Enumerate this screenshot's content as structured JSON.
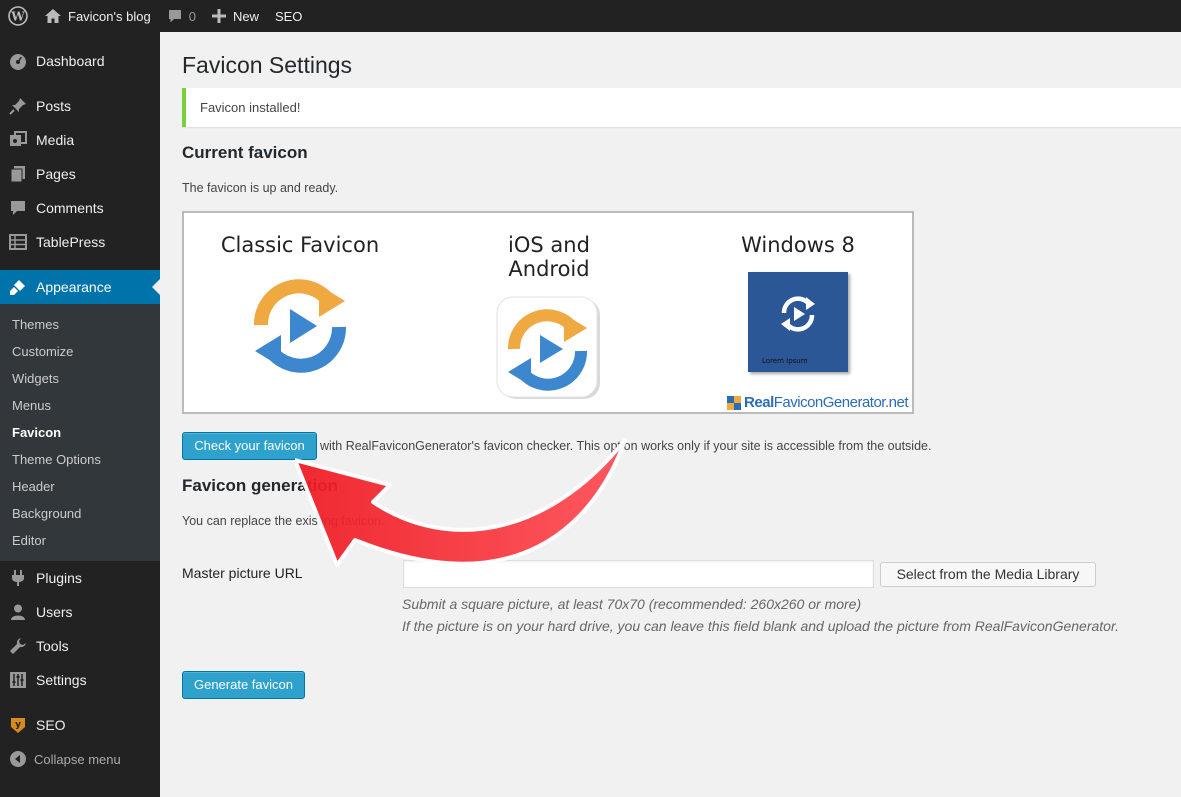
{
  "adminbar": {
    "site_name": "Favicon's blog",
    "comments_count": "0",
    "new_label": "New",
    "seo_label": "SEO"
  },
  "sidebar": {
    "items": [
      {
        "label": "Dashboard",
        "icon": "dashboard-icon"
      },
      {
        "label": "Posts",
        "icon": "pin-icon"
      },
      {
        "label": "Media",
        "icon": "media-icon"
      },
      {
        "label": "Pages",
        "icon": "pages-icon"
      },
      {
        "label": "Comments",
        "icon": "comment-icon"
      },
      {
        "label": "TablePress",
        "icon": "table-icon"
      },
      {
        "label": "Appearance",
        "icon": "brush-icon"
      }
    ],
    "appearance_submenu": [
      "Themes",
      "Customize",
      "Widgets",
      "Menus",
      "Favicon",
      "Theme Options",
      "Header",
      "Background",
      "Editor"
    ],
    "items_after": [
      {
        "label": "Plugins",
        "icon": "plug-icon"
      },
      {
        "label": "Users",
        "icon": "user-icon"
      },
      {
        "label": "Tools",
        "icon": "wrench-icon"
      },
      {
        "label": "Settings",
        "icon": "sliders-icon"
      },
      {
        "label": "SEO",
        "icon": "seo-icon"
      }
    ],
    "collapse_label": "Collapse menu"
  },
  "main": {
    "title": "Favicon Settings",
    "notice": "Favicon installed!",
    "current_heading": "Current favicon",
    "current_text": "The favicon is up and ready.",
    "preview": {
      "col1": "Classic Favicon",
      "col2": "iOS and Android",
      "col3": "Windows 8",
      "tile_text": "Lorem Ipsum",
      "brand_real": "Real",
      "brand_rest": "FaviconGenerator.net"
    },
    "check_button": "Check your favicon",
    "check_desc": "with RealFaviconGenerator's favicon checker. This option works only if your site is accessible from the outside.",
    "generation_heading": "Favicon generation",
    "generation_text": "You can replace the existing favicon.",
    "master_label": "Master picture URL",
    "master_value": "",
    "media_button": "Select from the Media Library",
    "hint1": "Submit a square picture, at least 70x70 (recommended: 260x260 or more)",
    "hint2": "If the picture is on your hard drive, you can leave this field blank and upload the picture from RealFaviconGenerator.",
    "generate_button": "Generate favicon"
  },
  "colors": {
    "adminbar_bg": "#222222",
    "sidebar_bg": "#222222",
    "sidebar_current": "#0073aa",
    "button_primary": "#2ea2cc",
    "notice_success": "#7ad03a",
    "arrow_red": "#ee1c24",
    "favicon_orange": "#f0a841",
    "favicon_blue": "#3d87cf",
    "win8_tile": "#2b5797"
  }
}
